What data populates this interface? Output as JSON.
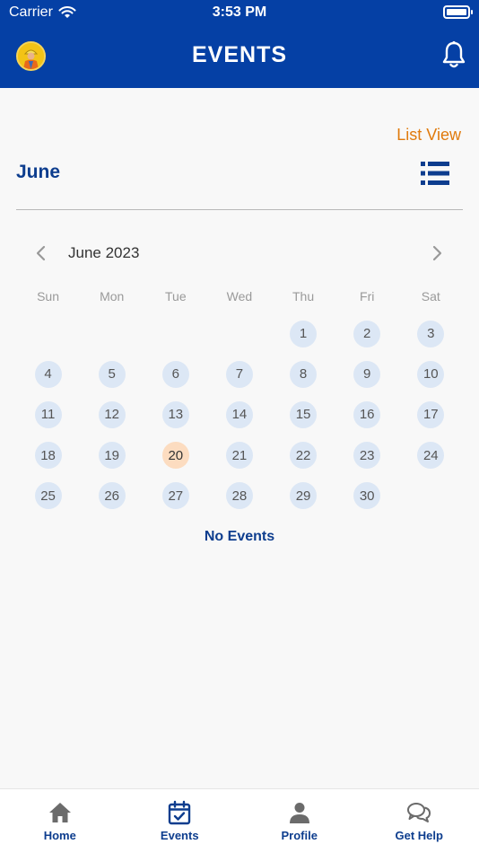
{
  "status_bar": {
    "carrier": "Carrier",
    "time": "3:53 PM"
  },
  "header": {
    "title": "EVENTS"
  },
  "toolbar": {
    "list_view_label": "List View",
    "month_heading": "June"
  },
  "calendar": {
    "title": "June 2023",
    "weekdays": [
      "Sun",
      "Mon",
      "Tue",
      "Wed",
      "Thu",
      "Fri",
      "Sat"
    ],
    "days": [
      "",
      "",
      "",
      "",
      "1",
      "2",
      "3",
      "4",
      "5",
      "6",
      "7",
      "8",
      "9",
      "10",
      "11",
      "12",
      "13",
      "14",
      "15",
      "16",
      "17",
      "18",
      "19",
      "20",
      "21",
      "22",
      "23",
      "24",
      "25",
      "26",
      "27",
      "28",
      "29",
      "30",
      ""
    ],
    "selected_day": "20"
  },
  "events": {
    "empty_label": "No Events"
  },
  "tabs": [
    {
      "label": "Home",
      "icon": "home-icon"
    },
    {
      "label": "Events",
      "icon": "calendar-icon"
    },
    {
      "label": "Profile",
      "icon": "person-icon"
    },
    {
      "label": "Get Help",
      "icon": "chat-bubbles-icon"
    }
  ],
  "colors": {
    "header_bg": "#0540a5",
    "accent_orange": "#e07a0c",
    "brand_navy": "#0d3d8e",
    "day_bg": "#dce7f5",
    "today_bg": "#fcdcc0"
  }
}
